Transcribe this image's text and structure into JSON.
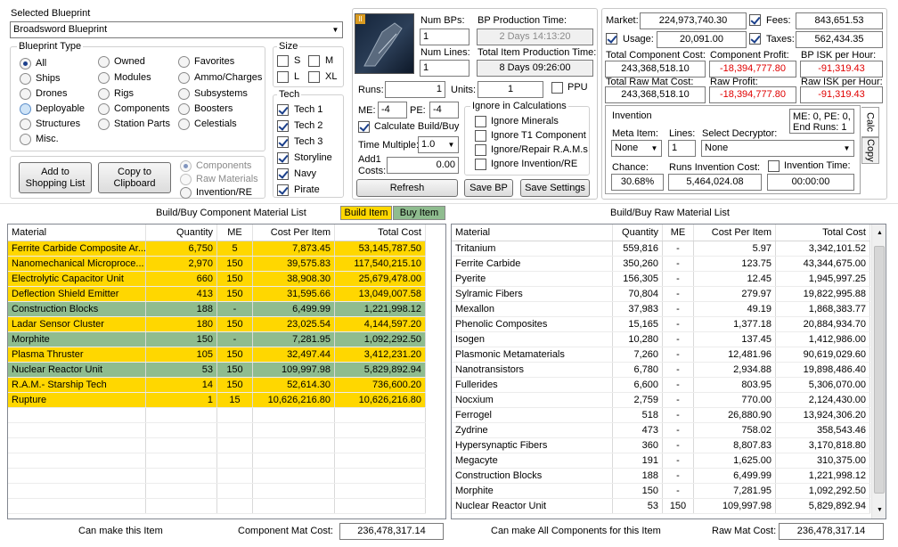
{
  "selected_blueprint": {
    "label": "Selected Blueprint",
    "value": "Broadsword Blueprint"
  },
  "blueprint_type": {
    "title": "Blueprint Type",
    "options": [
      "All",
      "Ships",
      "Drones",
      "Deployable",
      "Structures",
      "Misc.",
      "Owned",
      "Modules",
      "Rigs",
      "Components",
      "Station Parts",
      "Favorites",
      "Ammo/Charges",
      "Subsystems",
      "Boosters",
      "Celestials"
    ],
    "selected": "All"
  },
  "size": {
    "title": "Size",
    "options": [
      "S",
      "M",
      "L",
      "XL"
    ]
  },
  "tech": {
    "title": "Tech",
    "options": [
      "Tech 1",
      "Tech 2",
      "Tech 3",
      "Storyline",
      "Navy",
      "Pirate"
    ]
  },
  "actions": {
    "add_shopping": "Add to Shopping List",
    "copy_clipboard": "Copy to Clipboard"
  },
  "copy_options": [
    "Components",
    "Raw Materials",
    "Invention/RE"
  ],
  "bp": {
    "num_bps_label": "Num BPs:",
    "num_bps": "1",
    "num_lines_label": "Num Lines:",
    "num_lines": "1",
    "bp_prod_time_label": "BP Production Time:",
    "bp_prod_time": "2 Days 14:13:20",
    "total_prod_time_label": "Total Item Production Time:",
    "total_prod_time": "8 Days 09:26:00",
    "runs_label": "Runs:",
    "runs": "1",
    "units_label": "Units:",
    "units": "1",
    "ppu_label": "PPU",
    "me_label": "ME:",
    "me": "-4",
    "pe_label": "PE:",
    "pe": "-4",
    "calc_build_buy": "Calculate Build/Buy",
    "time_multiple_label": "Time Multiple:",
    "time_multiple": "1.0",
    "add1_costs_label": "Add1 Costs:",
    "add1_costs": "0.00",
    "refresh": "Refresh",
    "save_bp": "Save BP",
    "save_settings": "Save Settings"
  },
  "ignore": {
    "title": "Ignore in Calculations",
    "options": [
      "Ignore Minerals",
      "Ignore T1 Component",
      "Ignore/Repair R.A.M.s",
      "Ignore Invention/RE"
    ]
  },
  "summary": {
    "market_label": "Market:",
    "market": "224,973,740.30",
    "fees_label": "Fees:",
    "fees": "843,651.53",
    "usage_label": "Usage:",
    "usage": "20,091.00",
    "taxes_label": "Taxes:",
    "taxes": "562,434.35",
    "total_comp_cost_label": "Total Component Cost:",
    "total_comp_cost": "243,368,518.10",
    "comp_profit_label": "Component Profit:",
    "comp_profit": "-18,394,777.80",
    "bp_isk_hour_label": "BP ISK per Hour:",
    "bp_isk_hour": "-91,319.43",
    "total_raw_cost_label": "Total Raw Mat Cost:",
    "total_raw_cost": "243,368,518.10",
    "raw_profit_label": "Raw Profit:",
    "raw_profit": "-18,394,777.80",
    "raw_isk_hour_label": "Raw ISK per Hour:",
    "raw_isk_hour": "-91,319.43"
  },
  "invention": {
    "title": "Invention",
    "me_pe_end": "ME: 0, PE: 0, End Runs: 1",
    "meta_item_label": "Meta Item:",
    "meta_item": "None",
    "lines_label": "Lines:",
    "lines": "1",
    "decryptor_label": "Select Decryptor:",
    "decryptor": "None",
    "chance_label": "Chance:",
    "chance": "30.68%",
    "runs_cost_label": "Runs Invention Cost:",
    "runs_cost": "5,464,024.08",
    "inv_time_label": "Invention Time:",
    "inv_time": "00:00:00",
    "tab_calc": "Calc",
    "tab_copy": "Copy"
  },
  "component_list": {
    "title": "Build/Buy Component Material List",
    "legend_build": "Build Item",
    "legend_buy": "Buy Item",
    "headers": [
      "Material",
      "Quantity",
      "ME",
      "Cost Per Item",
      "Total Cost"
    ],
    "rows": [
      {
        "material": "Ferrite Carbide Composite Ar...",
        "quantity": "6,750",
        "me": "5",
        "cost": "7,873.45",
        "total": "53,145,787.50",
        "status": "build"
      },
      {
        "material": "Nanomechanical Microproce...",
        "quantity": "2,970",
        "me": "150",
        "cost": "39,575.83",
        "total": "117,540,215.10",
        "status": "build"
      },
      {
        "material": "Electrolytic Capacitor Unit",
        "quantity": "660",
        "me": "150",
        "cost": "38,908.30",
        "total": "25,679,478.00",
        "status": "build"
      },
      {
        "material": "Deflection Shield Emitter",
        "quantity": "413",
        "me": "150",
        "cost": "31,595.66",
        "total": "13,049,007.58",
        "status": "build"
      },
      {
        "material": "Construction Blocks",
        "quantity": "188",
        "me": "-",
        "cost": "6,499.99",
        "total": "1,221,998.12",
        "status": "buy"
      },
      {
        "material": "Ladar Sensor Cluster",
        "quantity": "180",
        "me": "150",
        "cost": "23,025.54",
        "total": "4,144,597.20",
        "status": "build"
      },
      {
        "material": "Morphite",
        "quantity": "150",
        "me": "-",
        "cost": "7,281.95",
        "total": "1,092,292.50",
        "status": "buy"
      },
      {
        "material": "Plasma Thruster",
        "quantity": "105",
        "me": "150",
        "cost": "32,497.44",
        "total": "3,412,231.20",
        "status": "build"
      },
      {
        "material": "Nuclear Reactor Unit",
        "quantity": "53",
        "me": "150",
        "cost": "109,997.98",
        "total": "5,829,892.94",
        "status": "buy"
      },
      {
        "material": "R.A.M.- Starship Tech",
        "quantity": "14",
        "me": "150",
        "cost": "52,614.30",
        "total": "736,600.20",
        "status": "build"
      },
      {
        "material": "Rupture",
        "quantity": "1",
        "me": "15",
        "cost": "10,626,216.80",
        "total": "10,626,216.80",
        "status": "build"
      }
    ],
    "footer_label": "Can make this Item",
    "cost_label": "Component Mat Cost:",
    "cost": "236,478,317.14"
  },
  "raw_list": {
    "title": "Build/Buy Raw Material List",
    "headers": [
      "Material",
      "Quantity",
      "ME",
      "Cost Per Item",
      "Total Cost"
    ],
    "rows": [
      {
        "material": "Tritanium",
        "quantity": "559,816",
        "me": "-",
        "cost": "5.97",
        "total": "3,342,101.52"
      },
      {
        "material": "Ferrite Carbide",
        "quantity": "350,260",
        "me": "-",
        "cost": "123.75",
        "total": "43,344,675.00"
      },
      {
        "material": "Pyerite",
        "quantity": "156,305",
        "me": "-",
        "cost": "12.45",
        "total": "1,945,997.25"
      },
      {
        "material": "Sylramic Fibers",
        "quantity": "70,804",
        "me": "-",
        "cost": "279.97",
        "total": "19,822,995.88"
      },
      {
        "material": "Mexallon",
        "quantity": "37,983",
        "me": "-",
        "cost": "49.19",
        "total": "1,868,383.77"
      },
      {
        "material": "Phenolic Composites",
        "quantity": "15,165",
        "me": "-",
        "cost": "1,377.18",
        "total": "20,884,934.70"
      },
      {
        "material": "Isogen",
        "quantity": "10,280",
        "me": "-",
        "cost": "137.45",
        "total": "1,412,986.00"
      },
      {
        "material": "Plasmonic Metamaterials",
        "quantity": "7,260",
        "me": "-",
        "cost": "12,481.96",
        "total": "90,619,029.60"
      },
      {
        "material": "Nanotransistors",
        "quantity": "6,780",
        "me": "-",
        "cost": "2,934.88",
        "total": "19,898,486.40"
      },
      {
        "material": "Fullerides",
        "quantity": "6,600",
        "me": "-",
        "cost": "803.95",
        "total": "5,306,070.00"
      },
      {
        "material": "Nocxium",
        "quantity": "2,759",
        "me": "-",
        "cost": "770.00",
        "total": "2,124,430.00"
      },
      {
        "material": "Ferrogel",
        "quantity": "518",
        "me": "-",
        "cost": "26,880.90",
        "total": "13,924,306.20"
      },
      {
        "material": "Zydrine",
        "quantity": "473",
        "me": "-",
        "cost": "758.02",
        "total": "358,543.46"
      },
      {
        "material": "Hypersynaptic Fibers",
        "quantity": "360",
        "me": "-",
        "cost": "8,807.83",
        "total": "3,170,818.80"
      },
      {
        "material": "Megacyte",
        "quantity": "191",
        "me": "-",
        "cost": "1,625.00",
        "total": "310,375.00"
      },
      {
        "material": "Construction Blocks",
        "quantity": "188",
        "me": "-",
        "cost": "6,499.99",
        "total": "1,221,998.12"
      },
      {
        "material": "Morphite",
        "quantity": "150",
        "me": "-",
        "cost": "7,281.95",
        "total": "1,092,292.50"
      },
      {
        "material": "Nuclear Reactor Unit",
        "quantity": "53",
        "me": "150",
        "cost": "109,997.98",
        "total": "5,829,892.94"
      }
    ],
    "footer_label": "Can make All Components for this Item",
    "cost_label": "Raw Mat Cost:",
    "cost": "236,478,317.14"
  },
  "colors": {
    "build": "#ffd700",
    "buy": "#8fbc8f",
    "negative": "#e00000"
  }
}
